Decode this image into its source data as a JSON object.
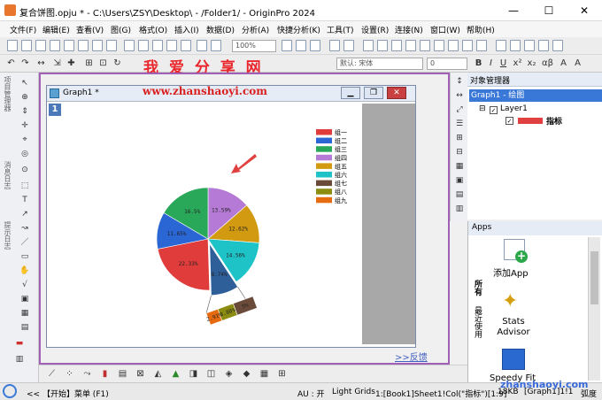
{
  "window": {
    "title": "复合饼图.opju * - C:\\Users\\ZSY\\Desktop\\ - /Folder1/ - OriginPro 2024",
    "minimize": "—",
    "maximize": "☐",
    "close": "✕"
  },
  "menu": [
    "文件(F)",
    "编辑(E)",
    "查看(V)",
    "图(G)",
    "格式(O)",
    "插入(I)",
    "数据(D)",
    "分析(A)",
    "快捷分析(K)",
    "工具(T)",
    "设置(R)",
    "连接(N)",
    "窗口(W)",
    "帮助(H)"
  ],
  "toolbar": {
    "zoom": "100%",
    "font": "默认: 宋体",
    "font_size": "0"
  },
  "watermark": {
    "cn": "我 爱 分 享 网",
    "url": "www.zhanshaoyi.com",
    "bottom": "zhanshaoyi.com"
  },
  "left_panel": {
    "project_explorer": "项目管理器",
    "message_log": "消息日志",
    "tips": "提示日志"
  },
  "graph_window": {
    "title": "Graph1 *",
    "layer": "1"
  },
  "feedback": ">>反馈",
  "object_manager": {
    "title": "对象管理器",
    "graph": "Graph1 - 绘图",
    "layer": "Layer1",
    "plot": "指标"
  },
  "apps": {
    "title": "Apps",
    "side_tab_1": "所有",
    "side_tab_2": "最近使用",
    "items": [
      {
        "label": "添加App"
      },
      {
        "label": "Stats Advisor"
      },
      {
        "label": "Speedy Fit"
      }
    ]
  },
  "status": {
    "start": "<< 【开始】菜单 (F1)",
    "au": "AU : 开",
    "grids": "Light Grids",
    "source": "1:[Book1]Sheet1!Col(\"指标\")[1:9]",
    "size": "18KB",
    "graph": "[Graph1]1!1",
    "unit": "弧度"
  },
  "chart_data": {
    "type": "pie",
    "title": "",
    "legend_position": "right",
    "slices": [
      {
        "name": "组一",
        "label": "13.59%",
        "value": 13.59,
        "color": "#b57ad6"
      },
      {
        "name": "组二",
        "label": "12.62%",
        "value": 12.62,
        "color": "#d19a10"
      },
      {
        "name": "组三",
        "label": "14.56%",
        "value": 14.56,
        "color": "#1ec3c8"
      },
      {
        "name": "组四",
        "label": "8.74%",
        "value": 8.74,
        "color": "#2e5f99",
        "exploded": true
      },
      {
        "name": "组五",
        "label": "22.33%",
        "value": 22.33,
        "color": "#e03c3c"
      },
      {
        "name": "组六",
        "label": "11.65%",
        "value": 11.65,
        "color": "#2a66d4"
      },
      {
        "name": "组七",
        "label": "16.5%",
        "value": 16.5,
        "color": "#2aa85a"
      }
    ],
    "sub_bar": [
      {
        "name": "组七",
        "label": "5%",
        "value": 5,
        "color": "#6a4a38"
      },
      {
        "name": "组八",
        "label": "3.88%",
        "value": 3.88,
        "color": "#8c8c10"
      },
      {
        "name": "组九",
        "label": "2.91%",
        "value": 2.91,
        "color": "#e66a10"
      }
    ],
    "legend": [
      {
        "name": "组一",
        "color": "#e03c3c"
      },
      {
        "name": "组二",
        "color": "#2a66d4"
      },
      {
        "name": "组三",
        "color": "#2aa85a"
      },
      {
        "name": "组四",
        "color": "#b57ad6"
      },
      {
        "name": "组五",
        "color": "#d19a10"
      },
      {
        "name": "组六",
        "color": "#1ec3c8"
      },
      {
        "name": "组七",
        "color": "#6a4a38"
      },
      {
        "name": "组八",
        "color": "#8c8c10"
      },
      {
        "name": "组九",
        "color": "#e66a10"
      }
    ]
  }
}
